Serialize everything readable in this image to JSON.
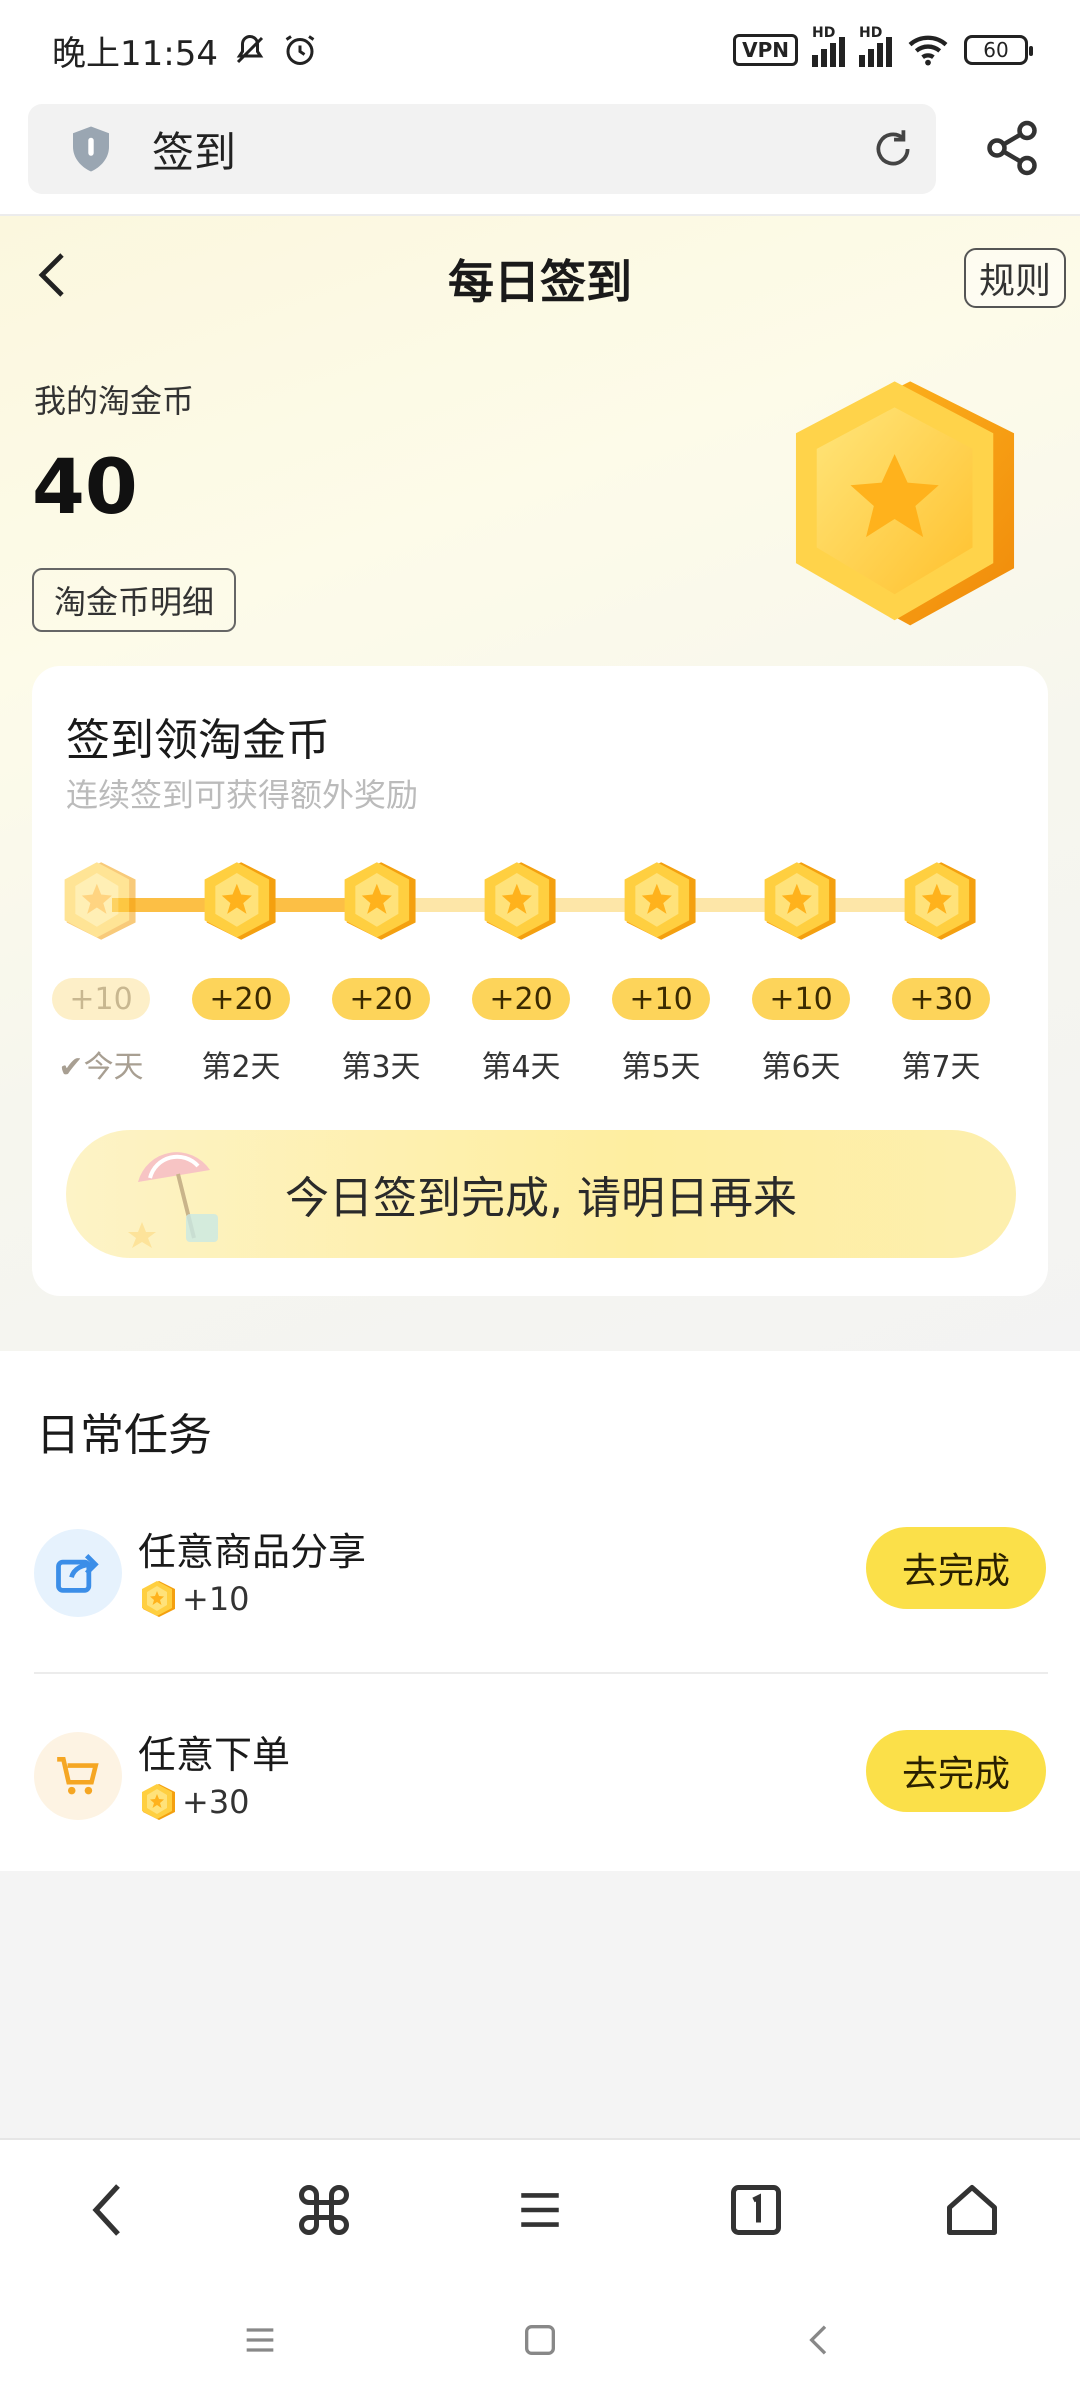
{
  "status": {
    "time": "晚上11:54",
    "vpn": "VPN",
    "hd1": "HD",
    "hd2": "HD",
    "battery": "60"
  },
  "url_bar": {
    "title": "签到"
  },
  "header": {
    "title": "每日签到",
    "rules_label": "规则"
  },
  "coins": {
    "label": "我的淘金币",
    "value": "40",
    "detail_label": "淘金币明细"
  },
  "signin": {
    "title": "签到领淘金币",
    "subtitle": "连续签到可获得额外奖励",
    "days": [
      {
        "reward": "+10",
        "label": "今天",
        "state": "past"
      },
      {
        "reward": "+20",
        "label": "第2天",
        "state": "future"
      },
      {
        "reward": "+20",
        "label": "第3天",
        "state": "future"
      },
      {
        "reward": "+20",
        "label": "第4天",
        "state": "future"
      },
      {
        "reward": "+10",
        "label": "第5天",
        "state": "future"
      },
      {
        "reward": "+10",
        "label": "第6天",
        "state": "future"
      },
      {
        "reward": "+30",
        "label": "第7天",
        "state": "future"
      }
    ],
    "checkmark": "✔",
    "done_text": "今日签到完成, 请明日再来"
  },
  "tasks": {
    "title": "日常任务",
    "items": [
      {
        "name": "任意商品分享",
        "reward": "+10",
        "button": "去完成",
        "icon": "share-icon",
        "icon_bg": "#e6f2fd",
        "icon_color": "#3b8ee8"
      },
      {
        "name": "任意下单",
        "reward": "+30",
        "button": "去完成",
        "icon": "cart-icon",
        "icon_bg": "#fdf3e3",
        "icon_color": "#f5a623"
      }
    ]
  },
  "colors": {
    "accent_yellow": "#fbe049",
    "coin_orange": "#fcbf45"
  }
}
